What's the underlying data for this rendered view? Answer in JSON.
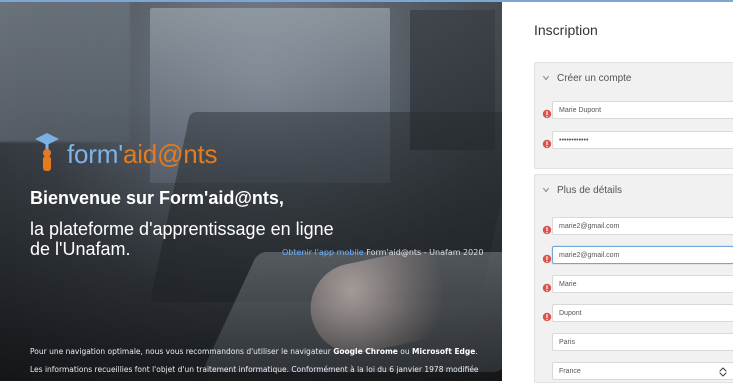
{
  "colors": {
    "topLine": "#7aa7d6",
    "logoBlue": "#7fb4ea",
    "logoOrange": "#e57b1f",
    "required": "#d9534f",
    "panel": "#f1f1f1",
    "focusBorder": "#73a6d8",
    "link": "#6fb2ff"
  },
  "hero": {
    "logo": {
      "prefix": "form'",
      "accent": "aid@nts",
      "icon": "graduation-cap-person-icon"
    },
    "welcome": "Bienvenue sur Form'aid@nts,",
    "subtitle_line1": "la plateforme d'apprentissage en ligne",
    "subtitle_line2": "de l'Unafam.",
    "app_link": "Obtenir l'app mobile",
    "copyright": "Form'aid@nts - Unafam 2020",
    "note_prefix": "Pour une navigation optimale, nous vous recommandons d'utiliser le navigateur",
    "note_browser1": "Google Chrome",
    "note_or": "ou",
    "note_browser2": "Microsoft Edge",
    "note_suffix": ".",
    "legal_line1": "Les informations recueillies font l'objet d'un traitement informatique. Conformément à la loi du 6 janvier 1978 modifiée"
  },
  "form": {
    "title": "Inscription",
    "sections": [
      {
        "header": "Créer un compte",
        "fields": [
          {
            "value": "Marie Dupont",
            "required": true
          },
          {
            "value": "••••••••••••",
            "required": true
          }
        ]
      },
      {
        "header": "Plus de détails",
        "fields": [
          {
            "value": "marie2@gmail.com",
            "required": true,
            "focused": false
          },
          {
            "value": "marie2@gmail.com",
            "required": true,
            "focused": true
          },
          {
            "value": "Marie",
            "required": true
          },
          {
            "value": "Dupont",
            "required": true
          },
          {
            "value": "Paris",
            "required": false
          },
          {
            "value": "France",
            "required": false,
            "select": true
          }
        ]
      }
    ]
  }
}
